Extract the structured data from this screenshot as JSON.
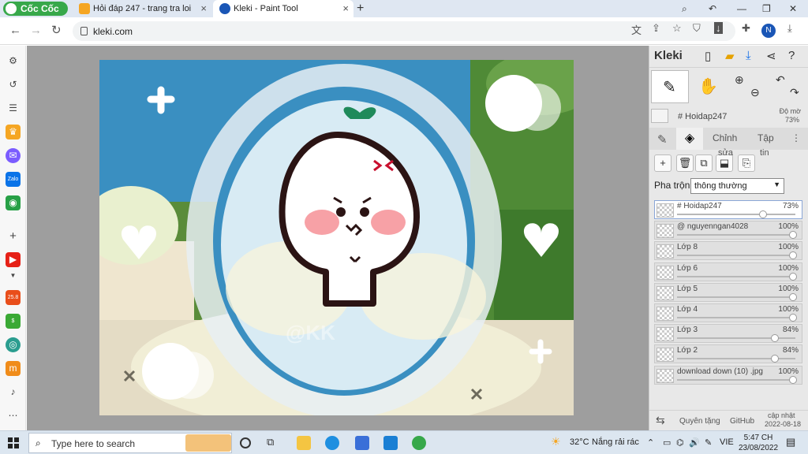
{
  "browser": {
    "brand": "Cốc Cốc",
    "tabs": [
      {
        "title": "Hỏi đáp 247 - trang tra loi",
        "active": false
      },
      {
        "title": "Kleki - Paint Tool",
        "active": true
      }
    ],
    "new_tab": "+",
    "address": "kleki.com",
    "profile_initial": "N"
  },
  "kleki": {
    "logo": "Kleki",
    "color_layer_name": "# Hoidap247",
    "opacity_label": "Độ mờ",
    "opacity_value": "73%",
    "tabs": [
      "Chỉnh",
      "Tập"
    ],
    "tab_sub": [
      "sửa",
      "tin"
    ],
    "blend_label": "Pha trộn",
    "blend_value": "thông thường",
    "layers": [
      {
        "name": "# Hoidap247",
        "opacity": "73%",
        "level": 0.73,
        "selected": true
      },
      {
        "name": "@ nguyenngan4028",
        "opacity": "100%",
        "level": 1.0,
        "selected": false
      },
      {
        "name": "Lớp 8",
        "opacity": "100%",
        "level": 1.0,
        "selected": false
      },
      {
        "name": "Lớp 6",
        "opacity": "100%",
        "level": 1.0,
        "selected": false
      },
      {
        "name": "Lớp 5",
        "opacity": "100%",
        "level": 1.0,
        "selected": false
      },
      {
        "name": "Lớp 4",
        "opacity": "100%",
        "level": 1.0,
        "selected": false
      },
      {
        "name": "Lớp 3",
        "opacity": "84%",
        "level": 0.84,
        "selected": false
      },
      {
        "name": "Lớp 2",
        "opacity": "84%",
        "level": 0.84,
        "selected": false
      },
      {
        "name": "download down (10) .jpg",
        "opacity": "100%",
        "level": 1.0,
        "selected": false
      }
    ],
    "footer": {
      "help": "Quyên tặng",
      "github": "GitHub",
      "update_label": "cập nhật",
      "update_date": "2022-08-18"
    }
  },
  "canvas": {
    "watermark": "@KK"
  },
  "taskbar": {
    "search_placeholder": "Type here to search",
    "weather_temp": "32°C",
    "weather_text": "Nắng rải rác",
    "language": "VIE",
    "time": "5:47 CH",
    "date": "23/08/2022"
  },
  "colors": {
    "accent": "#1a56b6",
    "brand_green": "#37a84a",
    "sky": "#3a8fc1"
  }
}
